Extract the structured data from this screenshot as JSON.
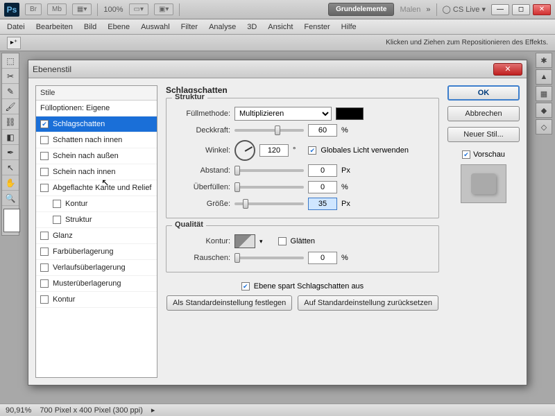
{
  "app": {
    "logo": "Ps"
  },
  "toolbar": {
    "br": "Br",
    "mb": "Mb",
    "zoom": "100%",
    "workspace1": "Grundelemente",
    "workspace2": "Malen",
    "cslive": "CS Live ▾"
  },
  "menu": [
    "Datei",
    "Bearbeiten",
    "Bild",
    "Ebene",
    "Auswahl",
    "Filter",
    "Analyse",
    "3D",
    "Ansicht",
    "Fenster",
    "Hilfe"
  ],
  "options_hint": "Klicken und Ziehen zum Repositionieren des Effekts.",
  "dialog": {
    "title": "Ebenenstil",
    "styles_header": "Stile",
    "fill_opts": "Fülloptionen: Eigene",
    "styles": [
      {
        "label": "Schlagschatten",
        "checked": true,
        "selected": true
      },
      {
        "label": "Schatten nach innen"
      },
      {
        "label": "Schein nach außen"
      },
      {
        "label": "Schein nach innen"
      },
      {
        "label": "Abgeflachte Kante und Relief"
      },
      {
        "label": "Kontur",
        "indent": true
      },
      {
        "label": "Struktur",
        "indent": true
      },
      {
        "label": "Glanz"
      },
      {
        "label": "Farbüberlagerung"
      },
      {
        "label": "Verlaufsüberlagerung"
      },
      {
        "label": "Musterüberlagerung"
      },
      {
        "label": "Kontur"
      }
    ],
    "panel_title": "Schlagschatten",
    "group_struct": "Struktur",
    "blend_label": "Füllmethode:",
    "blend_value": "Multiplizieren",
    "opacity_label": "Deckkraft:",
    "opacity_value": "60",
    "angle_label": "Winkel:",
    "angle_value": "120",
    "angle_unit": "°",
    "global_light": "Globales Licht verwenden",
    "distance_label": "Abstand:",
    "distance_value": "0",
    "spread_label": "Überfüllen:",
    "spread_value": "0",
    "size_label": "Größe:",
    "size_value": "35",
    "px": "Px",
    "pct": "%",
    "group_quality": "Qualität",
    "contour_label": "Kontur:",
    "antialias": "Glätten",
    "noise_label": "Rauschen:",
    "noise_value": "0",
    "knockout": "Ebene spart Schlagschatten aus",
    "set_default": "Als Standardeinstellung festlegen",
    "reset_default": "Auf Standardeinstellung zurücksetzen",
    "ok": "OK",
    "cancel": "Abbrechen",
    "new_style": "Neuer Stil...",
    "preview": "Vorschau"
  },
  "status": {
    "zoom": "90,91%",
    "doc": "700 Pixel x 400 Pixel (300 ppi)"
  }
}
